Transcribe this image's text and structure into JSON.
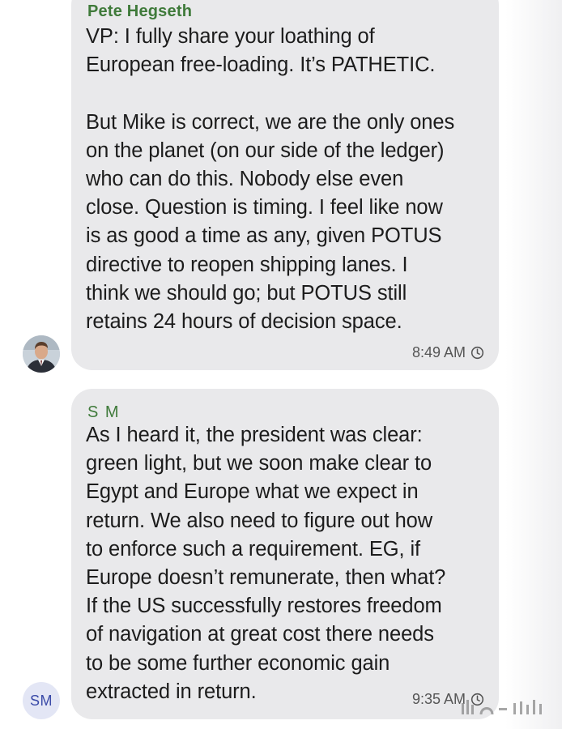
{
  "messages": [
    {
      "sender": "Pete Hegseth",
      "text": "VP: I fully share your loathing of\nEuropean free-loading. It’s PATHETIC.\n\nBut Mike is correct, we are the only ones\non the planet (on our side of the ledger)\nwho can do this. Nobody else even\nclose. Question is timing. I feel like now\nis as good a time as any, given POTUS\ndirective to reopen shipping lanes. I\nthink we should go; but POTUS still\nretains 24 hours of decision space.",
      "time": "8:49 AM",
      "status_icon": "clock-icon"
    },
    {
      "sender": "S M",
      "avatar_initials": "SM",
      "text": "As I heard it, the president was clear:\ngreen light, but we soon make clear to\nEgypt and Europe what we expect in\nreturn. We also need to figure out how\nto enforce such a requirement. EG, if\nEurope doesn’t remunerate, then what?\nIf the US successfully restores freedom\nof navigation at great cost there needs\nto be some further economic gain\nextracted in return.",
      "time": "9:35 AM",
      "status_icon": "clock-icon"
    }
  ],
  "colors": {
    "bubble": "#e9e9eb",
    "sender_name": "#3f7a3a",
    "initials_avatar_bg": "#e3e6f5",
    "initials_avatar_text": "#3a4aa8"
  }
}
